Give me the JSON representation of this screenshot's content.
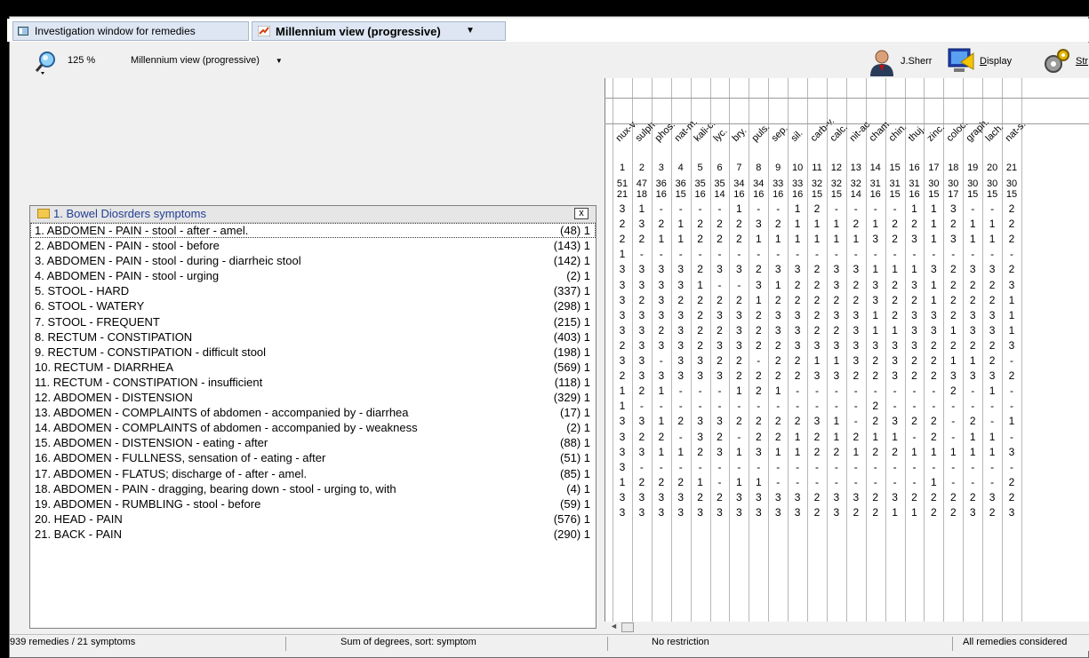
{
  "tabs": {
    "tab1_label": "Investigation window for remedies",
    "tab2_label": "Millennium view (progressive)"
  },
  "toolbar": {
    "zoom": "125 %",
    "view_select": "Millennium view (progressive)",
    "user": "J.Sherr",
    "display_label": "Display",
    "display_underline": "D",
    "display_rest": "isplay",
    "strategy_label": "Str"
  },
  "group": {
    "title": "1. Bowel Diosrders symptoms",
    "close": "x"
  },
  "remedies": [
    "nux-v.",
    "sulph.",
    "phos.",
    "nat-m.",
    "kali-c.",
    "lyc.",
    "bry.",
    "puls.",
    "sep.",
    "sil.",
    "carb-v.",
    "calc.",
    "nit-ac.",
    "cham.",
    "chin.",
    "thuj.",
    "zinc.",
    "coloc.",
    "graph.",
    "lach.",
    "nat-s."
  ],
  "remedy_numbers": [
    "1",
    "2",
    "3",
    "4",
    "5",
    "6",
    "7",
    "8",
    "9",
    "10",
    "11",
    "12",
    "13",
    "14",
    "15",
    "16",
    "17",
    "18",
    "19",
    "20",
    "21"
  ],
  "remedy_scores_top": [
    "51",
    "47",
    "36",
    "36",
    "35",
    "35",
    "34",
    "34",
    "33",
    "33",
    "32",
    "32",
    "32",
    "31",
    "31",
    "31",
    "30",
    "30",
    "30",
    "30",
    "30"
  ],
  "remedy_scores_bottom": [
    "21",
    "18",
    "16",
    "15",
    "16",
    "14",
    "16",
    "16",
    "16",
    "16",
    "15",
    "15",
    "14",
    "16",
    "15",
    "16",
    "15",
    "17",
    "15",
    "15",
    "15"
  ],
  "symptoms": [
    {
      "label": "1. ABDOMEN - PAIN - stool - after - amel.",
      "count": "(48) 1",
      "grades": [
        "3",
        "1",
        "-",
        "-",
        "-",
        "-",
        "1",
        "-",
        "-",
        "1",
        "2",
        "-",
        "-",
        "-",
        "-",
        "1",
        "1",
        "3",
        "-",
        "-",
        "2"
      ]
    },
    {
      "label": "2. ABDOMEN - PAIN - stool - before",
      "count": "(143) 1",
      "grades": [
        "2",
        "3",
        "2",
        "1",
        "2",
        "2",
        "2",
        "3",
        "2",
        "1",
        "1",
        "1",
        "2",
        "1",
        "2",
        "2",
        "1",
        "2",
        "1",
        "1",
        "2"
      ]
    },
    {
      "label": "3. ABDOMEN - PAIN - stool - during - diarrheic stool",
      "count": "(142) 1",
      "grades": [
        "2",
        "2",
        "1",
        "1",
        "2",
        "2",
        "2",
        "1",
        "1",
        "1",
        "1",
        "1",
        "1",
        "3",
        "2",
        "3",
        "1",
        "3",
        "1",
        "1",
        "2"
      ]
    },
    {
      "label": "4. ABDOMEN - PAIN - stool - urging",
      "count": "(2) 1",
      "grades": [
        "1",
        "-",
        "-",
        "-",
        "-",
        "-",
        "-",
        "-",
        "-",
        "-",
        "-",
        "-",
        "-",
        "-",
        "-",
        "-",
        "-",
        "-",
        "-",
        "-",
        "-"
      ]
    },
    {
      "label": "5. STOOL - HARD",
      "count": "(337) 1",
      "grades": [
        "3",
        "3",
        "3",
        "3",
        "2",
        "3",
        "3",
        "2",
        "3",
        "3",
        "2",
        "3",
        "3",
        "1",
        "1",
        "1",
        "3",
        "2",
        "3",
        "3",
        "2"
      ]
    },
    {
      "label": "6. STOOL - WATERY",
      "count": "(298) 1",
      "grades": [
        "3",
        "3",
        "3",
        "3",
        "1",
        "-",
        "-",
        "3",
        "1",
        "2",
        "2",
        "3",
        "2",
        "3",
        "2",
        "3",
        "1",
        "2",
        "2",
        "2",
        "3"
      ]
    },
    {
      "label": "7. STOOL - FREQUENT",
      "count": "(215) 1",
      "grades": [
        "3",
        "2",
        "3",
        "2",
        "2",
        "2",
        "2",
        "1",
        "2",
        "2",
        "2",
        "2",
        "2",
        "3",
        "2",
        "2",
        "1",
        "2",
        "2",
        "2",
        "1"
      ]
    },
    {
      "label": "8. RECTUM - CONSTIPATION",
      "count": "(403) 1",
      "grades": [
        "3",
        "3",
        "3",
        "3",
        "2",
        "3",
        "3",
        "2",
        "3",
        "3",
        "2",
        "3",
        "3",
        "1",
        "2",
        "3",
        "3",
        "2",
        "3",
        "3",
        "1"
      ]
    },
    {
      "label": "9. RECTUM - CONSTIPATION - difficult stool",
      "count": "(198) 1",
      "grades": [
        "3",
        "3",
        "2",
        "3",
        "2",
        "2",
        "3",
        "2",
        "3",
        "3",
        "2",
        "2",
        "3",
        "1",
        "1",
        "3",
        "3",
        "1",
        "3",
        "3",
        "1"
      ]
    },
    {
      "label": "10. RECTUM - DIARRHEA",
      "count": "(569) 1",
      "grades": [
        "2",
        "3",
        "3",
        "3",
        "2",
        "3",
        "3",
        "2",
        "2",
        "3",
        "3",
        "3",
        "3",
        "3",
        "3",
        "3",
        "2",
        "2",
        "2",
        "2",
        "3"
      ]
    },
    {
      "label": "11. RECTUM - CONSTIPATION - insufficient",
      "count": "(118) 1",
      "grades": [
        "3",
        "3",
        "-",
        "3",
        "3",
        "2",
        "2",
        "-",
        "2",
        "2",
        "1",
        "1",
        "3",
        "2",
        "3",
        "2",
        "2",
        "1",
        "1",
        "2",
        "-"
      ]
    },
    {
      "label": "12. ABDOMEN - DISTENSION",
      "count": "(329) 1",
      "grades": [
        "2",
        "3",
        "3",
        "3",
        "3",
        "3",
        "2",
        "2",
        "2",
        "2",
        "3",
        "3",
        "2",
        "2",
        "3",
        "2",
        "2",
        "3",
        "3",
        "3",
        "2"
      ]
    },
    {
      "label": "13. ABDOMEN - COMPLAINTS of abdomen - accompanied by - diarrhea",
      "count": "(17) 1",
      "grades": [
        "1",
        "2",
        "1",
        "-",
        "-",
        "-",
        "1",
        "2",
        "1",
        "-",
        "-",
        "-",
        "-",
        "-",
        "-",
        "-",
        "-",
        "2",
        "-",
        "1",
        "-"
      ]
    },
    {
      "label": "14. ABDOMEN - COMPLAINTS of abdomen - accompanied by - weakness",
      "count": "(2) 1",
      "grades": [
        "1",
        "-",
        "-",
        "-",
        "-",
        "-",
        "-",
        "-",
        "-",
        "-",
        "-",
        "-",
        "-",
        "2",
        "-",
        "-",
        "-",
        "-",
        "-",
        "-",
        "-"
      ]
    },
    {
      "label": "15. ABDOMEN - DISTENSION - eating - after",
      "count": "(88) 1",
      "grades": [
        "3",
        "3",
        "1",
        "2",
        "3",
        "3",
        "2",
        "2",
        "2",
        "2",
        "3",
        "1",
        "-",
        "2",
        "3",
        "2",
        "2",
        "-",
        "2",
        "-",
        "1"
      ]
    },
    {
      "label": "16. ABDOMEN - FULLNESS, sensation of - eating - after",
      "count": "(51) 1",
      "grades": [
        "3",
        "2",
        "2",
        "-",
        "3",
        "2",
        "-",
        "2",
        "2",
        "1",
        "2",
        "1",
        "2",
        "1",
        "1",
        "-",
        "2",
        "-",
        "1",
        "1",
        "-"
      ]
    },
    {
      "label": "17. ABDOMEN - FLATUS; discharge of - after - amel.",
      "count": "(85) 1",
      "grades": [
        "3",
        "3",
        "1",
        "1",
        "2",
        "3",
        "1",
        "3",
        "1",
        "1",
        "2",
        "2",
        "1",
        "2",
        "2",
        "1",
        "1",
        "1",
        "1",
        "1",
        "3"
      ]
    },
    {
      "label": "18. ABDOMEN - PAIN - dragging, bearing down - stool - urging to, with",
      "count": "(4) 1",
      "grades": [
        "3",
        "-",
        "-",
        "-",
        "-",
        "-",
        "-",
        "-",
        "-",
        "-",
        "-",
        "-",
        "-",
        "-",
        "-",
        "-",
        "-",
        "-",
        "-",
        "-",
        "-"
      ]
    },
    {
      "label": "19. ABDOMEN - RUMBLING - stool - before",
      "count": "(59) 1",
      "grades": [
        "1",
        "2",
        "2",
        "2",
        "1",
        "-",
        "1",
        "1",
        "-",
        "-",
        "-",
        "-",
        "-",
        "-",
        "-",
        "-",
        "1",
        "-",
        "-",
        "-",
        "2"
      ]
    },
    {
      "label": "20. HEAD - PAIN",
      "count": "(576) 1",
      "grades": [
        "3",
        "3",
        "3",
        "3",
        "2",
        "2",
        "3",
        "3",
        "3",
        "3",
        "2",
        "3",
        "3",
        "2",
        "3",
        "2",
        "2",
        "2",
        "2",
        "3",
        "2"
      ]
    },
    {
      "label": "21. BACK - PAIN",
      "count": "(290) 1",
      "grades": [
        "3",
        "3",
        "3",
        "3",
        "3",
        "3",
        "3",
        "3",
        "3",
        "3",
        "2",
        "3",
        "2",
        "2",
        "1",
        "1",
        "2",
        "2",
        "3",
        "2",
        "3"
      ]
    }
  ],
  "status": {
    "left": "939 remedies / 21 symptoms",
    "sort": "Sum of degrees, sort: symptom",
    "restriction": "No restriction",
    "considered": "All remedies considered"
  }
}
